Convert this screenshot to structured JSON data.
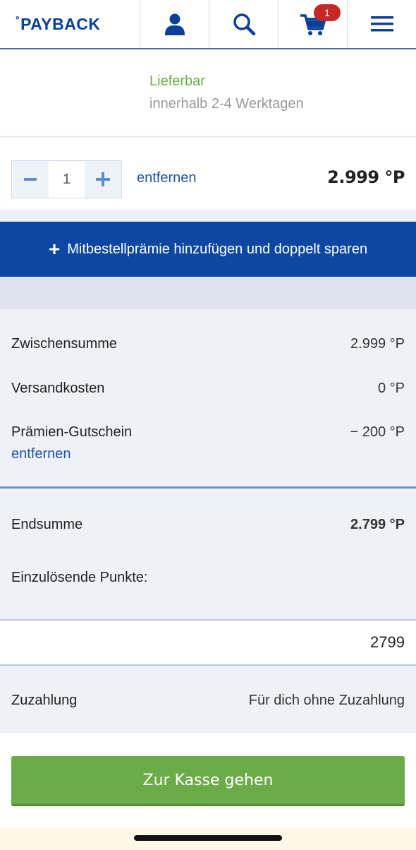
{
  "header": {
    "logo_degree": "°",
    "logo_text": "PAYBACK",
    "cart_count": "1",
    "icons": [
      "user-icon",
      "search-icon",
      "cart-icon",
      "menu-icon"
    ],
    "brand_color": "#0a3f99",
    "accent_color": "#3f6fb5"
  },
  "product": {
    "availability": "Lieferbar",
    "delivery_time": "innerhalb 2-4 Werktagen",
    "quantity": "1",
    "remove_label": "entfernen",
    "price": "2.999 °P"
  },
  "banner": {
    "plus": "+",
    "label": "Mitbestellprämie hinzufügen und doppelt sparen"
  },
  "summary": {
    "subtotal_label": "Zwischensumme",
    "subtotal_value": "2.999 °P",
    "shipping_label": "Versandkosten",
    "shipping_value": "0 °P",
    "voucher_label": "Prämien-Gutschein",
    "voucher_value": "− 200 °P",
    "voucher_remove": "entfernen"
  },
  "total": {
    "label": "Endsumme",
    "value": "2.799 °P",
    "points_label": "Einzulösende Punkte:",
    "points_value": "2799"
  },
  "copay": {
    "label": "Zuzahlung",
    "value": "Für dich ohne Zuzahlung"
  },
  "checkout": {
    "label": "Zur Kasse gehen",
    "color": "#6bac48"
  }
}
